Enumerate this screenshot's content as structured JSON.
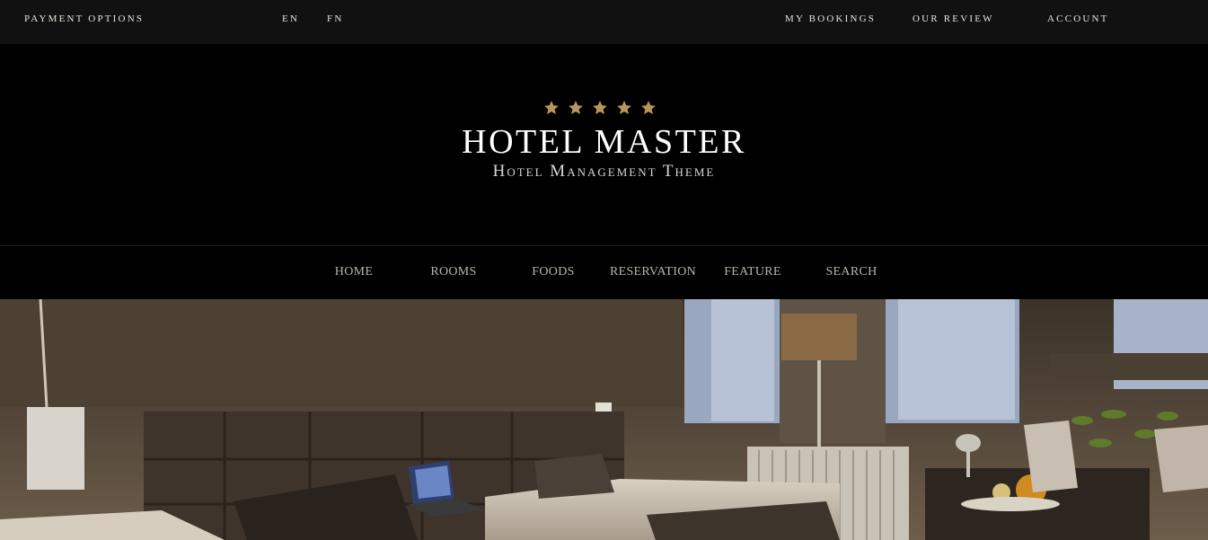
{
  "topbar": {
    "payment": "PAYMENT OPTIONS",
    "lang_en": "EN",
    "lang_fn": "FN",
    "bookings": "MY BOOKINGS",
    "review": "OUR REVIEW",
    "account": "ACCOUNT"
  },
  "brand": {
    "stars": 5,
    "star_color": "#b9955c",
    "title": "HOTEL MASTER",
    "subtitle": "Hotel Management Theme"
  },
  "nav": {
    "items": [
      "HOME",
      "ROOMS",
      "FOODS",
      "RESERVATION",
      "FEATURE",
      "SEARCH"
    ]
  },
  "colors": {
    "topbar_bg": "#111111",
    "header_bg": "#000000",
    "accent": "#b9955c"
  }
}
